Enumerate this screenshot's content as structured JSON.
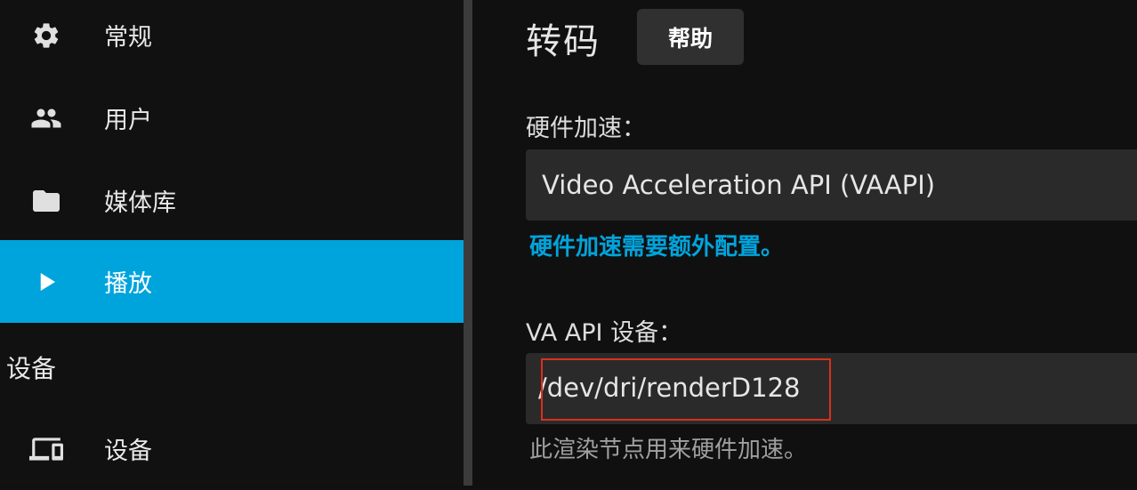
{
  "sidebar": {
    "items": [
      {
        "label": "常规",
        "icon": "gear-icon"
      },
      {
        "label": "用户",
        "icon": "people-icon"
      },
      {
        "label": "媒体库",
        "icon": "folder-icon"
      },
      {
        "label": "播放",
        "icon": "play-icon",
        "active": true
      }
    ],
    "section_header": "设备",
    "section_items": [
      {
        "label": "设备",
        "icon": "devices-icon"
      }
    ]
  },
  "main": {
    "title": "转码",
    "help_label": "帮助",
    "hw_accel": {
      "label": "硬件加速：",
      "value": "Video Acceleration API (VAAPI)",
      "link": "硬件加速需要额外配置。"
    },
    "vaapi_device": {
      "label": "VA API 设备：",
      "value": "/dev/dri/renderD128",
      "description": "此渲染节点用来硬件加速。"
    }
  },
  "colors": {
    "accent": "#00a4dc",
    "highlight_border": "#d9301f",
    "background": "#101010",
    "field_background": "#2a2a2a"
  }
}
